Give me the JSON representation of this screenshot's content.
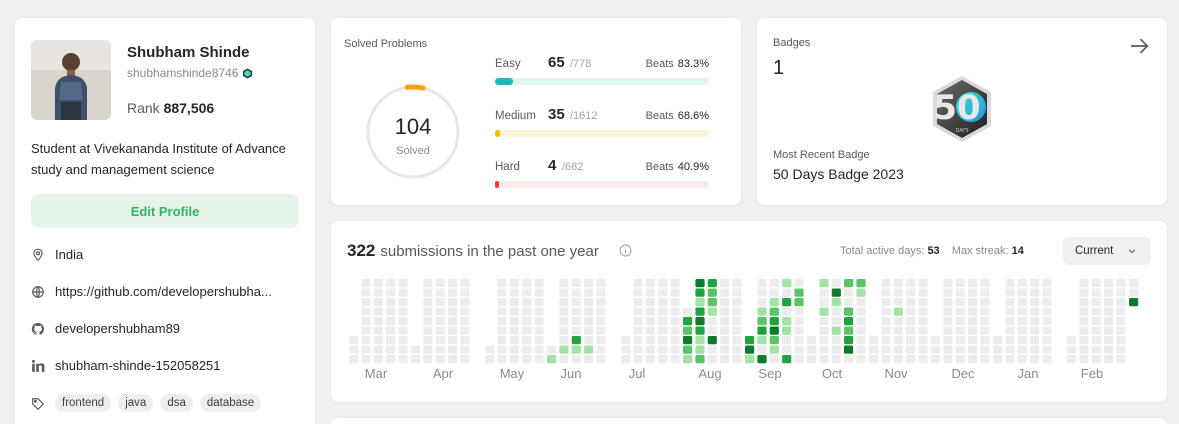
{
  "profile": {
    "name": "Shubham Shinde",
    "username": "shubhamshinde8746",
    "rank_label": "Rank",
    "rank_value": "887,506",
    "bio": "Student at Vivekananda Institute of Advance study and management science",
    "edit_label": "Edit Profile",
    "location": "India",
    "website": "https://github.com/developershubha...",
    "github": "developershubham89",
    "linkedin": "shubham-shinde-152058251",
    "tags": [
      "frontend",
      "java",
      "dsa",
      "database"
    ]
  },
  "solved": {
    "title": "Solved Problems",
    "total": "104",
    "total_label": "Solved",
    "difficulties": [
      {
        "label": "Easy",
        "count": "65",
        "total": "/778",
        "beats_label": "Beats",
        "beats": "83.3%",
        "fill": 0.0835,
        "color": "#1cbaba",
        "track": "#dff3ef"
      },
      {
        "label": "Medium",
        "count": "35",
        "total": "/1612",
        "beats_label": "Beats",
        "beats": "68.6%",
        "fill": 0.0217,
        "color": "#ffb700",
        "track": "#fff3d6"
      },
      {
        "label": "Hard",
        "count": "4",
        "total": "/682",
        "beats_label": "Beats",
        "beats": "40.9%",
        "fill": 0.0059,
        "color": "#f63737",
        "track": "#fde8e8"
      }
    ]
  },
  "badges": {
    "title": "Badges",
    "count": "1",
    "recent_label": "Most Recent Badge",
    "recent_name": "50 Days Badge 2023",
    "badge_icon": "fifty-days-badge-icon",
    "badge_text": "50",
    "badge_sub": "DAYS"
  },
  "submissions": {
    "count": "322",
    "text": "submissions in the past one year",
    "active_label": "Total active days:",
    "active_value": "53",
    "streak_label": "Max streak:",
    "streak_value": "14",
    "dropdown": "Current",
    "months": [
      "Mar",
      "Apr",
      "May",
      "Jun",
      "Jul",
      "Aug",
      "Sep",
      "Oct",
      "Nov",
      "Dec",
      "Jan",
      "Feb"
    ]
  },
  "colors": {
    "accent_green": "#2db55d",
    "heat_empty": "#ececec",
    "heat_levels": [
      "#ececec",
      "#a3e3a5",
      "#5bc466",
      "#23a340",
      "#0e7a2c"
    ]
  }
}
